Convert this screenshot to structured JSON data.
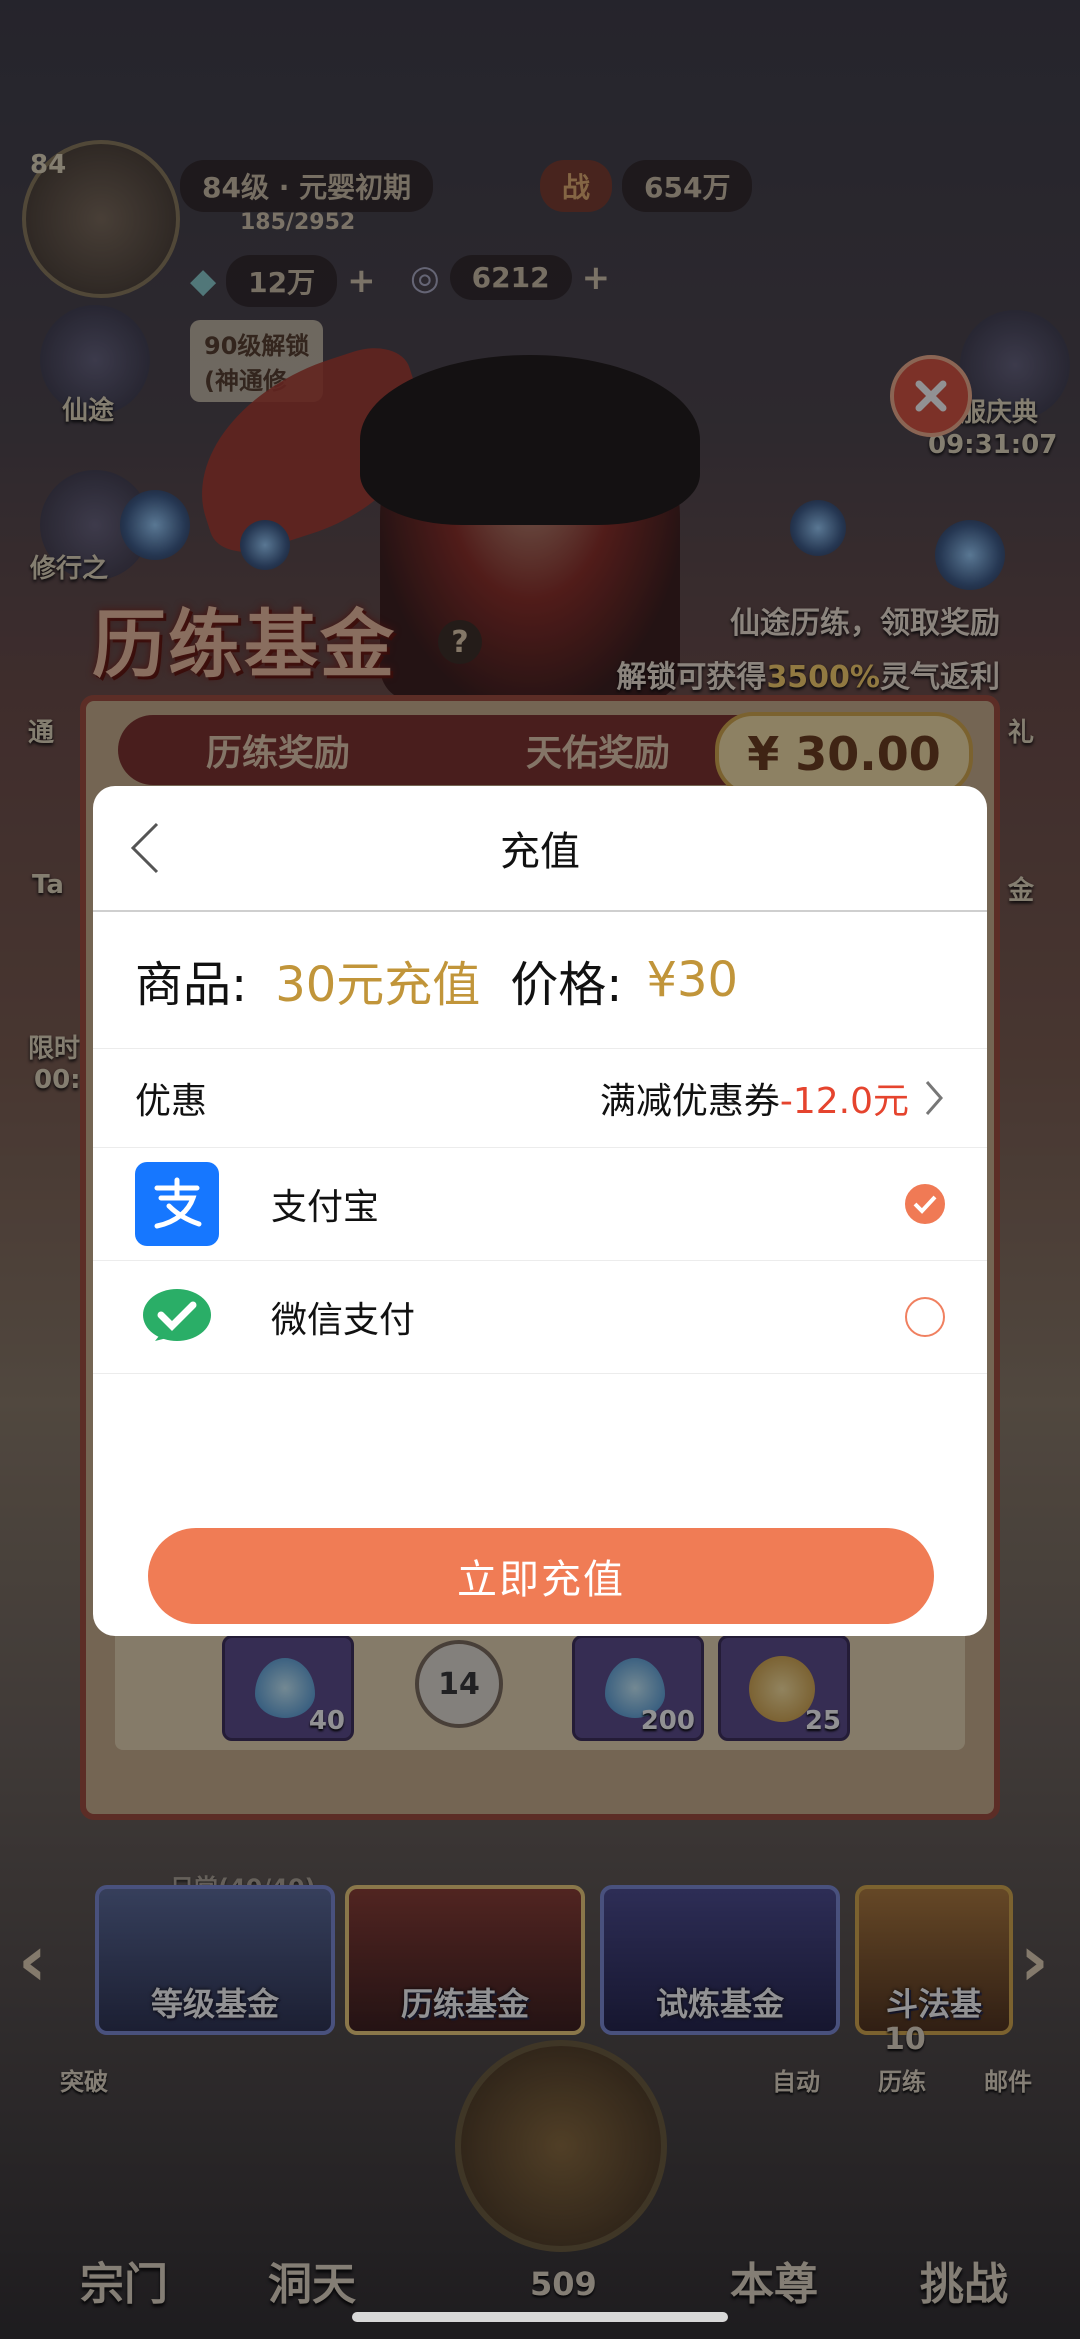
{
  "hud": {
    "level_badge": "84",
    "level_title": "84级 · 元婴初期",
    "exp": "185/2952",
    "power_icon_label": "战",
    "power": "654万",
    "currency1": "12万",
    "currency2": "6212",
    "plus": "+",
    "unlock_line1": "90级解锁",
    "unlock_line2": "(神通修"
  },
  "side": {
    "xiantu": "仙途",
    "xiuxing": "修行之",
    "tongxing": "通",
    "ta": "Ta",
    "xianshi": "限时",
    "timer_left": "00:",
    "qingdian": "服庆典",
    "qingdian_time": "09:31:07",
    "right_label": "礼",
    "right_label2": "金"
  },
  "banner": {
    "title": "历练基金",
    "slogan1": "仙途历练，领取奖励",
    "slogan2_prefix": "解锁可获得",
    "slogan2_highlight": "3500%",
    "slogan2_suffix": "灵气返利",
    "help": "?"
  },
  "fund_panel": {
    "tab1": "历练奖励",
    "tab2": "天佑奖励",
    "price": "¥ 30.00",
    "node_level": "14",
    "rewards": [
      "40",
      "200",
      "25"
    ]
  },
  "modal": {
    "title": "充值",
    "product_label": "商品:",
    "product_value": "30元充值",
    "price_label": "价格:",
    "price_value": "¥30",
    "discount_label": "优惠",
    "coupon_text": "满减优惠券",
    "coupon_value": "-12.0元",
    "payment_methods": [
      {
        "name": "支付宝",
        "selected": true
      },
      {
        "name": "微信支付",
        "selected": false
      }
    ],
    "submit": "立即充值"
  },
  "fund_tabs": [
    "等级基金",
    "历练基金",
    "试炼基金",
    "斗法基"
  ],
  "status_row": {
    "left_text": "日常(40/40)",
    "tupo": "突破",
    "zidong": "自动",
    "lilian": "历练",
    "lilian_num": "10",
    "youjian": "邮件"
  },
  "dock": {
    "zongmen": "宗门",
    "dongtian": "洞天",
    "center_num": "509",
    "benzun": "本尊",
    "tiaozhan": "挑战"
  },
  "colors": {
    "accent": "#f07c55",
    "alipay": "#1677ff",
    "wechat": "#2aae67",
    "gold_text": "#c1953a",
    "discount_red": "#e5442e"
  }
}
